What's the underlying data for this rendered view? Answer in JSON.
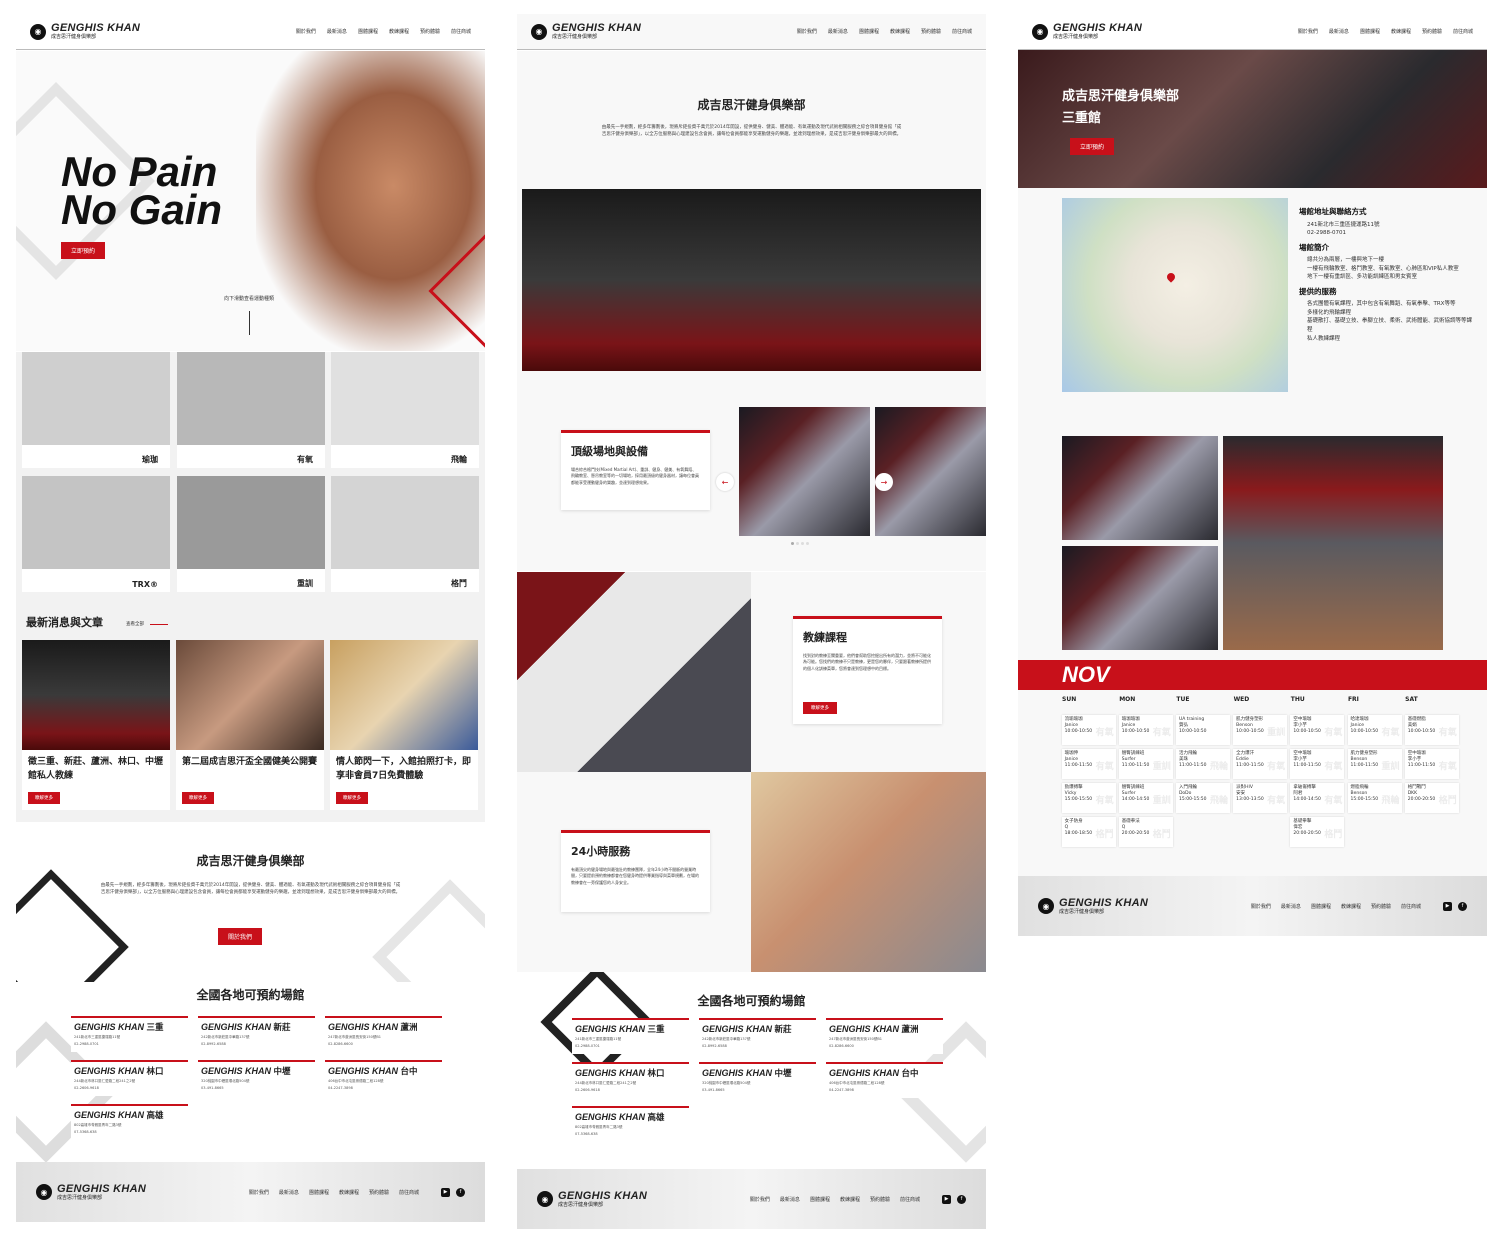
{
  "brand": {
    "name_en": "GENGHIS KHAN",
    "name_zh": "成吉思汗健身俱樂部"
  },
  "nav": [
    "關於我們",
    "最新消息",
    "團體課程",
    "教練課程",
    "預約體驗",
    "前往商城"
  ],
  "hero": {
    "line1": "No Pain",
    "line2": "No Gain",
    "cta": "立即預約",
    "scroll_hint": "向下滑動查看運動種類"
  },
  "classes": [
    {
      "label": "瑜珈"
    },
    {
      "label": "有氧"
    },
    {
      "label": "飛輪"
    },
    {
      "label": "TRX®"
    },
    {
      "label": "重訓"
    },
    {
      "label": "格鬥"
    }
  ],
  "news": {
    "title": "最新消息與文章",
    "view_all": "查看全部",
    "items": [
      {
        "title": "徵三重、新莊、蘆洲、林口、中壢館私人教練",
        "btn": "瞭解更多"
      },
      {
        "title": "第二屆成吉思汗盃全國健美公開賽",
        "btn": "瞭解更多"
      },
      {
        "title": "情人節閃一下，入館拍照打卡，即享非會員7日免費體驗",
        "btn": "瞭解更多"
      }
    ]
  },
  "about": {
    "title": "成吉思汗健身俱樂部",
    "desc": "由最先一手規劃，經多年籌劃後，現將斥鉅投資千萬元於2014年開設，提供健身、健美、體適能、有氧運動及現代武術相關服務之綜合項目健身館「成吉思汗健身俱樂部」，以全方位服務與心理建設包含會員，讓每位會員都能享受運動健身的樂趣，並達到理想效果，是成吉思汗健身俱樂部最大的目標。",
    "btn": "關於我們"
  },
  "locations": {
    "title": "全國各地可預約場館",
    "items": [
      {
        "brand": "GENGHIS KHAN",
        "city": "三重",
        "addr": "241新北市三重區捷運路11號",
        "tel": "02-2988-0701"
      },
      {
        "brand": "GENGHIS KHAN",
        "city": "新莊",
        "addr": "242新北市新莊區中華路137號",
        "tel": "02-8992-6588"
      },
      {
        "brand": "GENGHIS KHAN",
        "city": "蘆洲",
        "addr": "247新北市蘆洲區長安街150號B1",
        "tel": "02-8286-6600"
      },
      {
        "brand": "GENGHIS KHAN",
        "city": "林口",
        "addr": "244新北市林口區仁愛路二段241之2號",
        "tel": "02-2606-9618"
      },
      {
        "brand": "GENGHIS KHAN",
        "city": "中壢",
        "addr": "320桃園市中壢區環北路504號",
        "tel": "03-491-8665"
      },
      {
        "brand": "GENGHIS KHAN",
        "city": "台中",
        "addr": "406台中市北屯區崇德路二段128號",
        "tel": "04-2247-3898"
      },
      {
        "brand": "GENGHIS KHAN",
        "city": "高雄",
        "addr": "802高雄市苓雅區青年二路3號",
        "tel": "07-5368-638"
      }
    ]
  },
  "facility": {
    "title": "頂級場地與設備",
    "desc": "場合綜合格鬥技(Mixed Martial Art)、重訓、健身、健美、有氧舞蹈、飛輪教室、懸吊教室等的一切場地，採用最頂級的健身器材，讓每位會員都能享受運動健身的樂趣，並達到理想效果。"
  },
  "coach": {
    "title": "教練課程",
    "desc": "找到對的教練至關重要，他們會幫助您挖掘出所有的潛力，並將不可能化為可能。您找們的教練不只是教練，更是您的夥伴，只要跟著教練所提供的個人化訓練菜單，您將會達到您理想中的目標。",
    "btn": "瞭解更多"
  },
  "service": {
    "title": "24小時服務",
    "desc": "有最頂尖的健身場地與最強壯的教練團隊，全年24小時不間斷的營業時間，只要提前預約教練都會在您健身時提供專業指導與菜單規劃，在場的教練會在一旁保護您的人身安全。"
  },
  "branch": {
    "title_line1": "成吉思汗健身俱樂部",
    "title_line2": "三重館",
    "cta": "立即預約",
    "info_title": "場館地址與聯絡方式",
    "info": [
      "241新北市三重區捷運路11號",
      "02-2988-0701"
    ],
    "intro_title": "場館簡介",
    "intro": [
      "總共分為兩層，一樓與地下一樓",
      "一樓有飛輪教室、格鬥教室、有氧教室、心肺區和VIP私人教室",
      "地下一樓有重訓區、多功能訓練區和男女賓室"
    ],
    "services_title": "提供的服務",
    "services": [
      "各式團體有氧課程，其中包含有氧舞蹈、有氧拳擊、TRX等等",
      "多樣化的飛輪課程",
      "基礎散打、基礎立技、拳腳立技、柔術、武術體能、武術協調等等課程",
      "私人教練課程"
    ]
  },
  "calendar": {
    "month": "NOV",
    "days": [
      "SUN",
      "MON",
      "TUE",
      "WED",
      "THU",
      "FRI",
      "SAT"
    ],
    "rows": [
      [
        {
          "name": "流瑜瑜珈",
          "coach": "Janice",
          "time": "10:00-10:50",
          "wm": "有氧"
        },
        {
          "name": "瑜珈瑜珈",
          "coach": "Janice",
          "time": "10:00-10:50",
          "wm": "有氧"
        },
        {
          "name": "UA training",
          "coach": "賀弘",
          "time": "10:00-10:50",
          "wm": ""
        },
        {
          "name": "肌力健身塑形",
          "coach": "Benson",
          "time": "10:00-10:50",
          "wm": "重訓"
        },
        {
          "name": "空中瑜珈",
          "coach": "李小芋",
          "time": "10:00-10:50",
          "wm": "有氧"
        },
        {
          "name": "哈達瑜珈",
          "coach": "Janice",
          "time": "10:00-10:50",
          "wm": "有氧"
        },
        {
          "name": "基礎燃脂",
          "coach": "美娟",
          "time": "10:00-10:50",
          "wm": "有氧"
        }
      ],
      [
        {
          "name": "瑜珈伸",
          "coach": "Janice",
          "time": "11:00-11:50",
          "wm": "有氧"
        },
        {
          "name": "翹臀訓練班",
          "coach": "Surfer",
          "time": "11:00-11:50",
          "wm": "重訓"
        },
        {
          "name": "活力飛輪",
          "coach": "美珠",
          "time": "11:00-11:50",
          "wm": "飛輪"
        },
        {
          "name": "全力爆汗",
          "coach": "Eddie",
          "time": "11:00-11:50",
          "wm": "有氧"
        },
        {
          "name": "空中瑜珈",
          "coach": "李小芋",
          "time": "11:00-11:50",
          "wm": "有氧"
        },
        {
          "name": "肌力健身塑形",
          "coach": "Benson",
          "time": "11:00-11:50",
          "wm": "重訓"
        },
        {
          "name": "空中瑜珈",
          "coach": "李小芋",
          "time": "11:00-11:50",
          "wm": "有氧"
        }
      ],
      [
        {
          "name": "勁爆搏擊",
          "coach": "Vicky",
          "time": "15:00-15:50",
          "wm": "有氧"
        },
        {
          "name": "翹臀訓練班",
          "coach": "Surfer",
          "time": "14:00-14:50",
          "wm": "重訓"
        },
        {
          "name": "入門飛輪",
          "coach": "DoDo",
          "time": "15:00-15:50",
          "wm": "飛輪"
        },
        {
          "name": "派對HIV",
          "coach": "安安",
          "time": "13:00-13:50",
          "wm": "有氧"
        },
        {
          "name": "拿破崙搏擊",
          "coach": "阿君",
          "time": "14:00-14:50",
          "wm": "有氧"
        },
        {
          "name": "燃脂飛輪",
          "coach": "Benson",
          "time": "15:00-15:50",
          "wm": "飛輪"
        },
        {
          "name": "格鬥戰鬥",
          "coach": "DKK",
          "time": "20:00-20:50",
          "wm": "格鬥"
        }
      ],
      [
        {
          "name": "女子防身",
          "coach": "Q",
          "time": "18:00-18:50",
          "wm": "格鬥"
        },
        {
          "name": "基礎拳法",
          "coach": "Q",
          "time": "20:00-20:50",
          "wm": "格鬥"
        },
        null,
        null,
        {
          "name": "基礎拳擊",
          "coach": "偉宏",
          "time": "20:00-20:50",
          "wm": "格鬥"
        },
        null,
        null
      ]
    ]
  }
}
